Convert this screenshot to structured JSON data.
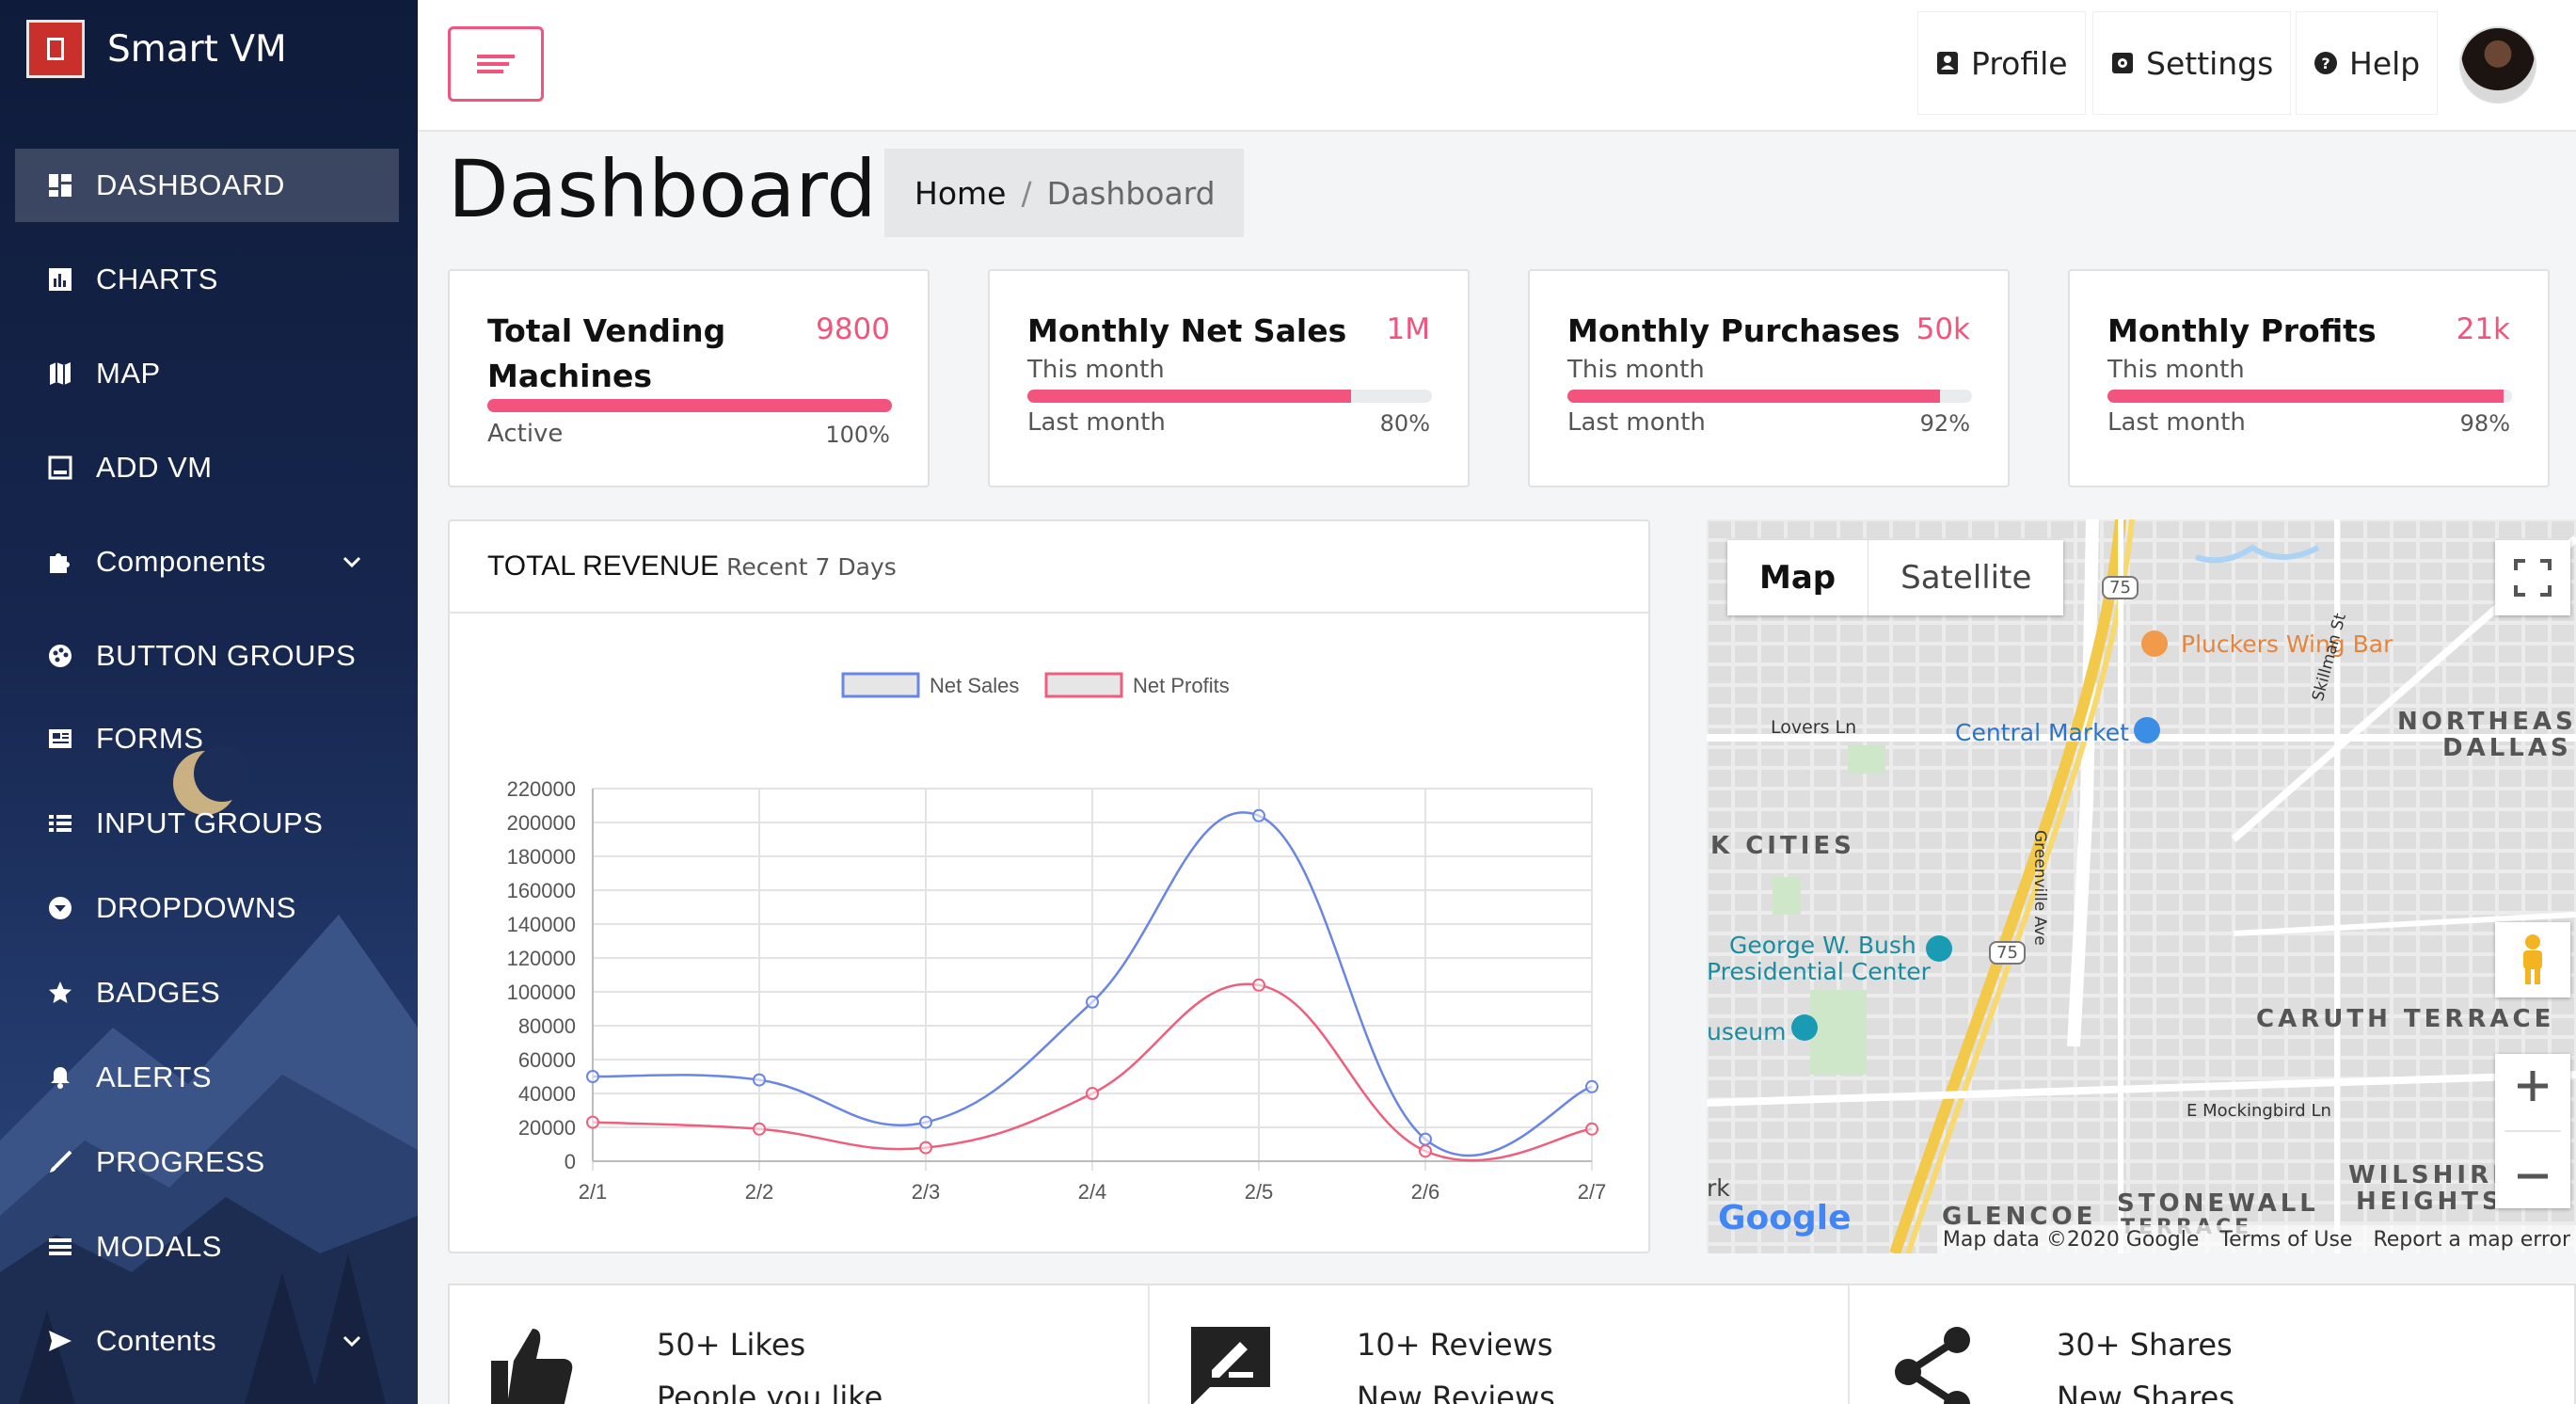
{
  "brand": {
    "name": "Smart VM"
  },
  "sidebar": {
    "items": [
      {
        "label": "DASHBOARD",
        "icon": "dashboard-icon",
        "active": true
      },
      {
        "label": "CHARTS",
        "icon": "chart-icon"
      },
      {
        "label": "MAP",
        "icon": "map-icon"
      },
      {
        "label": "ADD VM",
        "icon": "add-vm-icon"
      },
      {
        "label": "Components",
        "icon": "puzzle-icon",
        "expandable": true
      },
      {
        "label": "BUTTON GROUPS",
        "icon": "palette-icon"
      },
      {
        "label": "FORMS",
        "icon": "form-icon"
      },
      {
        "label": "INPUT GROUPS",
        "icon": "list-icon"
      },
      {
        "label": "DROPDOWNS",
        "icon": "dropdown-icon"
      },
      {
        "label": "BADGES",
        "icon": "star-icon"
      },
      {
        "label": "ALERTS",
        "icon": "bell-icon"
      },
      {
        "label": "PROGRESS",
        "icon": "brush-icon"
      },
      {
        "label": "MODALS",
        "icon": "menu-icon"
      },
      {
        "label": "Contents",
        "icon": "send-icon",
        "expandable": true
      }
    ]
  },
  "topbar": {
    "profile": "Profile",
    "settings": "Settings",
    "help": "Help"
  },
  "page": {
    "title": "Dashboard"
  },
  "breadcrumb": {
    "home": "Home",
    "separator": "/",
    "current": "Dashboard"
  },
  "stats": [
    {
      "title": "Total Vending Machines",
      "value": "9800",
      "sub1": "Active",
      "sub2": "",
      "percent": "100%",
      "progress": 1.0
    },
    {
      "title": "Monthly Net Sales",
      "value": "1M",
      "sub1": "This month",
      "sub2": "Last month",
      "percent": "80%",
      "progress": 0.8
    },
    {
      "title": "Monthly Purchases",
      "value": "50k",
      "sub1": "This month",
      "sub2": "Last month",
      "percent": "92%",
      "progress": 0.92
    },
    {
      "title": "Monthly Profits",
      "value": "21k",
      "sub1": "This month",
      "sub2": "Last month",
      "percent": "98%",
      "progress": 0.98
    }
  ],
  "revenue": {
    "title": "TOTAL REVENUE",
    "subtitle": "Recent 7 Days"
  },
  "chart_data": {
    "type": "line",
    "title": "",
    "xlabel": "",
    "ylabel": "",
    "categories": [
      "2/1",
      "2/2",
      "2/3",
      "2/4",
      "2/5",
      "2/6",
      "2/7"
    ],
    "ylim": [
      0,
      220000
    ],
    "yticks": [
      0,
      20000,
      40000,
      60000,
      80000,
      100000,
      120000,
      140000,
      160000,
      180000,
      200000,
      220000
    ],
    "grid": true,
    "legend": "top-center",
    "series": [
      {
        "name": "Net Sales",
        "color": "#6a86e4",
        "values": [
          50000,
          48000,
          23000,
          94000,
          204000,
          13000,
          44000
        ]
      },
      {
        "name": "Net Profits",
        "color": "#ef5f7d",
        "values": [
          23000,
          19000,
          8000,
          40000,
          104000,
          6000,
          19000
        ]
      }
    ]
  },
  "map": {
    "tab_map": "Map",
    "tab_satellite": "Satellite",
    "places": {
      "pluckers": "Pluckers Wing Bar",
      "central_market": "Central Market",
      "bush_center_1": "George W. Bush",
      "bush_center_2": "Presidential Center",
      "museum": "useum",
      "park": "rk",
      "lovers_ln": "Lovers Ln",
      "greenville": "Greenville Ave",
      "skillman": "Skillman St",
      "mockingbird": "E Mockingbird Ln",
      "hwy75": "75",
      "northeast1": "NORTHEAS",
      "northeast2": "DALLAS",
      "cities": "K CITIES",
      "caruth": "CARUTH TERRACE",
      "wilshire1": "WILSHIRI",
      "wilshire2": "HEIGHTS",
      "stonewall1": "STONEWALL",
      "stonewall2": "TERRACE",
      "glencoe": "GLENCOE"
    },
    "footer": {
      "data": "Map data ©2020 Google",
      "terms": "Terms of Use",
      "report": "Report a map error"
    },
    "google": "Google"
  },
  "bottom": [
    {
      "count": "50+ Likes",
      "desc": "People you like",
      "icon": "thumbs-up-icon"
    },
    {
      "count": "10+ Reviews",
      "desc": "New Reviews",
      "icon": "review-icon"
    },
    {
      "count": "30+ Shares",
      "desc": "New Shares",
      "icon": "share-icon"
    }
  ]
}
